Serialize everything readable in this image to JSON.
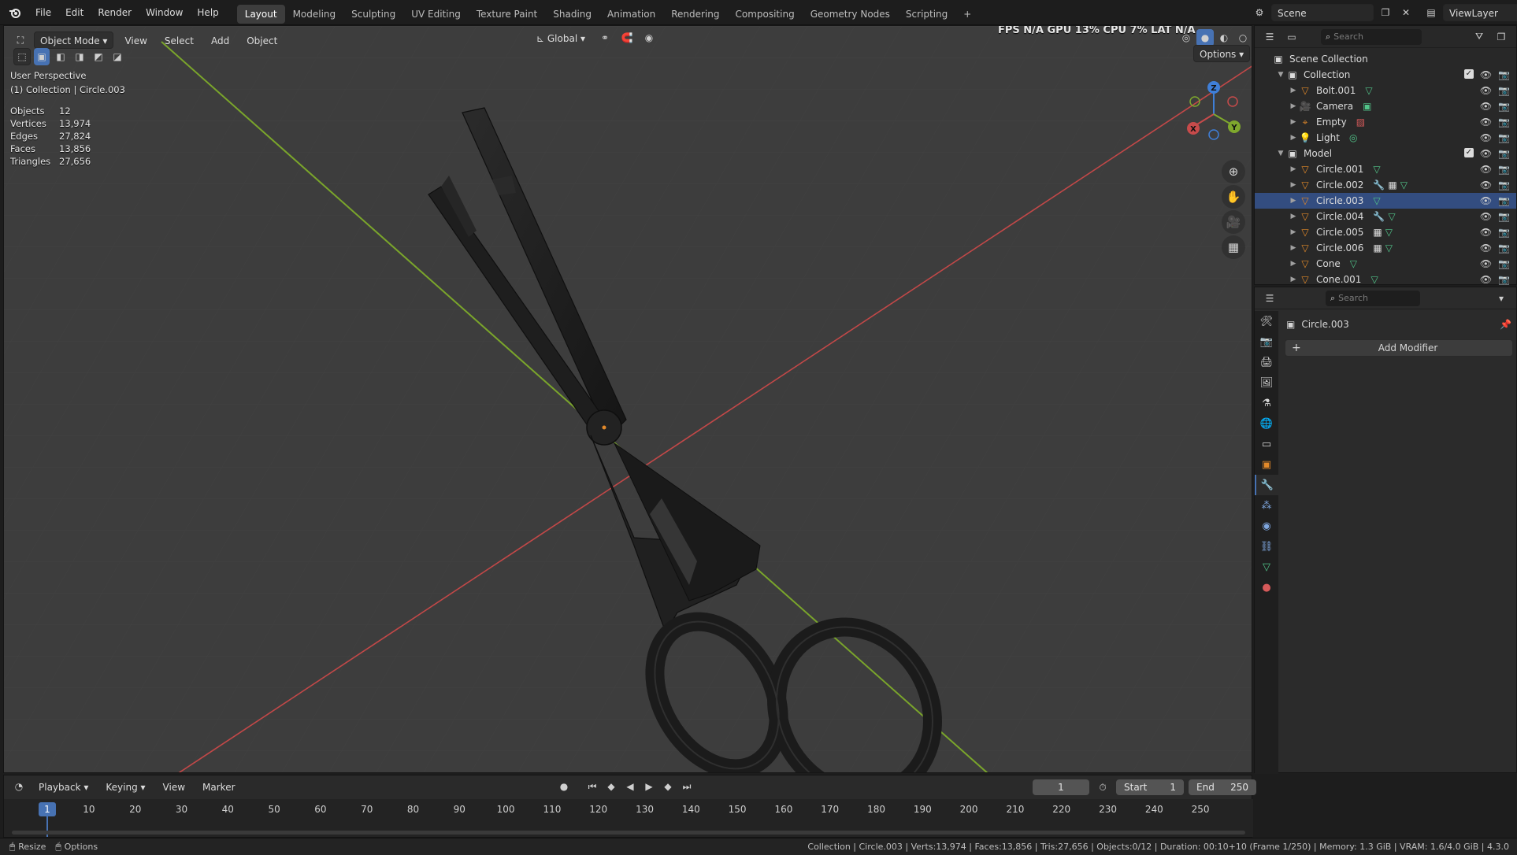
{
  "top_menu": [
    "File",
    "Edit",
    "Render",
    "Window",
    "Help"
  ],
  "workspaces": [
    "Layout",
    "Modeling",
    "Sculpting",
    "UV Editing",
    "Texture Paint",
    "Shading",
    "Animation",
    "Rendering",
    "Compositing",
    "Geometry Nodes",
    "Scripting"
  ],
  "active_workspace": "Layout",
  "add_workspace_glyph": "+",
  "scene_name": "Scene",
  "view_layer": "ViewLayer",
  "viewport": {
    "mode": "Object Mode",
    "menus": [
      "View",
      "Select",
      "Add",
      "Object"
    ],
    "orientation": "Global",
    "options_label": "Options",
    "perf_overlay": "FPS N/A GPU 13% CPU 7% LAT N/A",
    "view_name": "User Perspective",
    "context": "(1) Collection | Circle.003",
    "stats": [
      {
        "key": "Objects",
        "value": "12"
      },
      {
        "key": "Vertices",
        "value": "13,974"
      },
      {
        "key": "Edges",
        "value": "27,824"
      },
      {
        "key": "Faces",
        "value": "13,856"
      },
      {
        "key": "Triangles",
        "value": "27,656"
      }
    ],
    "gizmo": {
      "x": "X",
      "y": "Y",
      "z": "Z"
    }
  },
  "outliner": {
    "search_placeholder": "Search",
    "root": "Scene Collection",
    "collection": "Collection",
    "collection_items": [
      "Bolt.001",
      "Camera",
      "Empty",
      "Light"
    ],
    "model": "Model",
    "model_items": [
      "Circle.001",
      "Circle.002",
      "Circle.003",
      "Circle.004",
      "Circle.005",
      "Circle.006",
      "Cone",
      "Cone.001"
    ],
    "selected": "Circle.003"
  },
  "properties": {
    "search_placeholder": "Search",
    "object_name": "Circle.003",
    "add_modifier": "Add Modifier",
    "add_glyph": "+"
  },
  "timeline": {
    "menus": [
      "Playback",
      "Keying",
      "View",
      "Marker"
    ],
    "current_frame": "1",
    "start_label": "Start",
    "start": "1",
    "end_label": "End",
    "end": "250",
    "ticks": [
      "10",
      "20",
      "30",
      "40",
      "50",
      "60",
      "70",
      "80",
      "90",
      "100",
      "110",
      "120",
      "130",
      "140",
      "150",
      "160",
      "170",
      "180",
      "190",
      "200",
      "210",
      "220",
      "230",
      "240",
      "250"
    ]
  },
  "statusbar": {
    "left_items": [
      "Resize",
      "Options"
    ],
    "info": "Collection | Circle.003 | Verts:13,974 | Faces:13,856 | Tris:27,656 | Objects:0/12 | Duration: 00:10+10 (Frame 1/250) | Memory: 1.3 GiB | VRAM: 1.6/4.0 GiB | 4.3.0"
  },
  "colors": {
    "accent": "#4772b3",
    "x_axis": "#c74b4b",
    "y_axis": "#7fa82d",
    "z_axis": "#3f7fd8",
    "object_orange": "#e2892a",
    "mesh_green": "#52c58a"
  }
}
